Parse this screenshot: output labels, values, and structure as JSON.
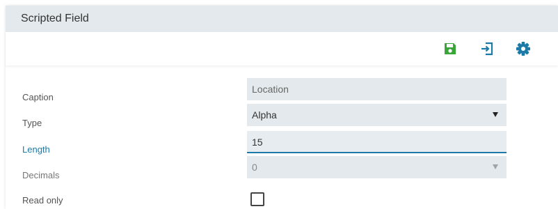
{
  "panel": {
    "title": "Scripted Field"
  },
  "toolbar": {
    "save_icon": "save-icon",
    "exit_icon": "exit-icon",
    "settings_icon": "gear-icon",
    "save_color": "#3aa63a",
    "exit_color": "#1b7aa8",
    "settings_color": "#1b7aa8"
  },
  "form": {
    "caption": {
      "label": "Caption",
      "value": "Location"
    },
    "type": {
      "label": "Type",
      "value": "Alpha"
    },
    "length": {
      "label": "Length",
      "value": "15"
    },
    "decimals": {
      "label": "Decimals",
      "value": "0"
    },
    "read_only": {
      "label": "Read only",
      "checked": false
    }
  },
  "colors": {
    "accent": "#1b7aa8",
    "field_bg": "#e3e9ec",
    "title_bg": "#e3e9ec"
  }
}
